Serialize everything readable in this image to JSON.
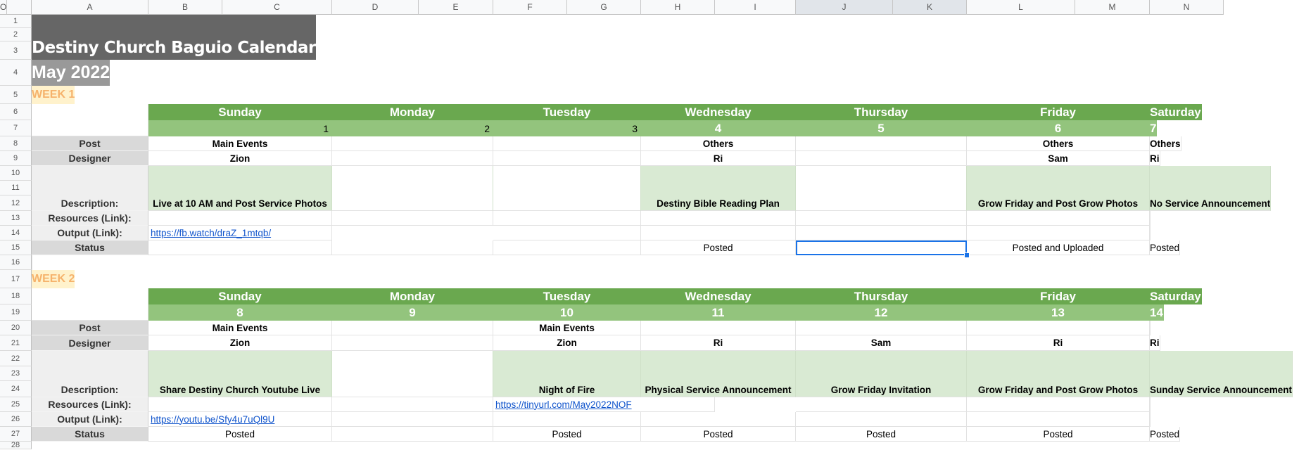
{
  "columns": [
    "A",
    "B",
    "C",
    "D",
    "E",
    "F",
    "G",
    "H",
    "I",
    "J",
    "K",
    "L",
    "M",
    "N",
    "O"
  ],
  "rows": [
    "1",
    "2",
    "3",
    "4",
    "5",
    "6",
    "7",
    "8",
    "9",
    "10",
    "11",
    "12",
    "13",
    "14",
    "15",
    "16",
    "17",
    "18",
    "19",
    "20",
    "21",
    "22",
    "23",
    "24",
    "25",
    "26",
    "27",
    "28"
  ],
  "title": "Destiny Church Baguio Calendar",
  "month": "May 2022",
  "days": [
    "Sunday",
    "Monday",
    "Tuesday",
    "Wednesday",
    "Thursday",
    "Friday",
    "Saturday"
  ],
  "labels": {
    "post": "Post",
    "designer": "Designer",
    "description": "Description:",
    "resources": "Resources (Link):",
    "output": "Output (Link):",
    "status": "Status"
  },
  "week1": {
    "label": "WEEK 1",
    "dates": [
      "1",
      "2",
      "3",
      "4",
      "5",
      "6",
      "7"
    ],
    "post": [
      "Main Events",
      "",
      "",
      "Others",
      "",
      "Others",
      "Others"
    ],
    "designer": [
      "Zion",
      "",
      "",
      "Ri",
      "",
      "Sam",
      "Ri"
    ],
    "description": [
      "Live at 10 AM and Post Service Photos",
      "",
      "",
      "Destiny Bible Reading Plan",
      "",
      "Grow Friday and Post Grow Photos",
      "No Service Announcement"
    ],
    "output_link": "https://fb.watch/draZ_1mtqb/",
    "status": [
      "",
      "",
      "",
      "Posted",
      "",
      "Posted and Uploaded",
      "Posted"
    ]
  },
  "week2": {
    "label": "WEEK 2",
    "dates": [
      "8",
      "9",
      "10",
      "11",
      "12",
      "13",
      "14"
    ],
    "post": [
      "Main Events",
      "",
      "Main Events",
      "",
      "",
      "",
      ""
    ],
    "designer": [
      "Zion",
      "",
      "Zion",
      "Ri",
      "Sam",
      "Ri",
      "Ri"
    ],
    "description": [
      "Share Destiny Church Youtube Live",
      "",
      "Night of Fire",
      "Physical Service Announcement",
      "Grow Friday Invitation",
      "Grow Friday and Post Grow Photos",
      "Sunday Service Announcement"
    ],
    "resources_link": "https://tinyurl.com/May2022NOF",
    "output_link": "https://youtu.be/Sfy4u7uQl9U",
    "status": [
      "Posted",
      "",
      "Posted",
      "Posted",
      "Posted",
      "Posted",
      "Posted"
    ]
  }
}
